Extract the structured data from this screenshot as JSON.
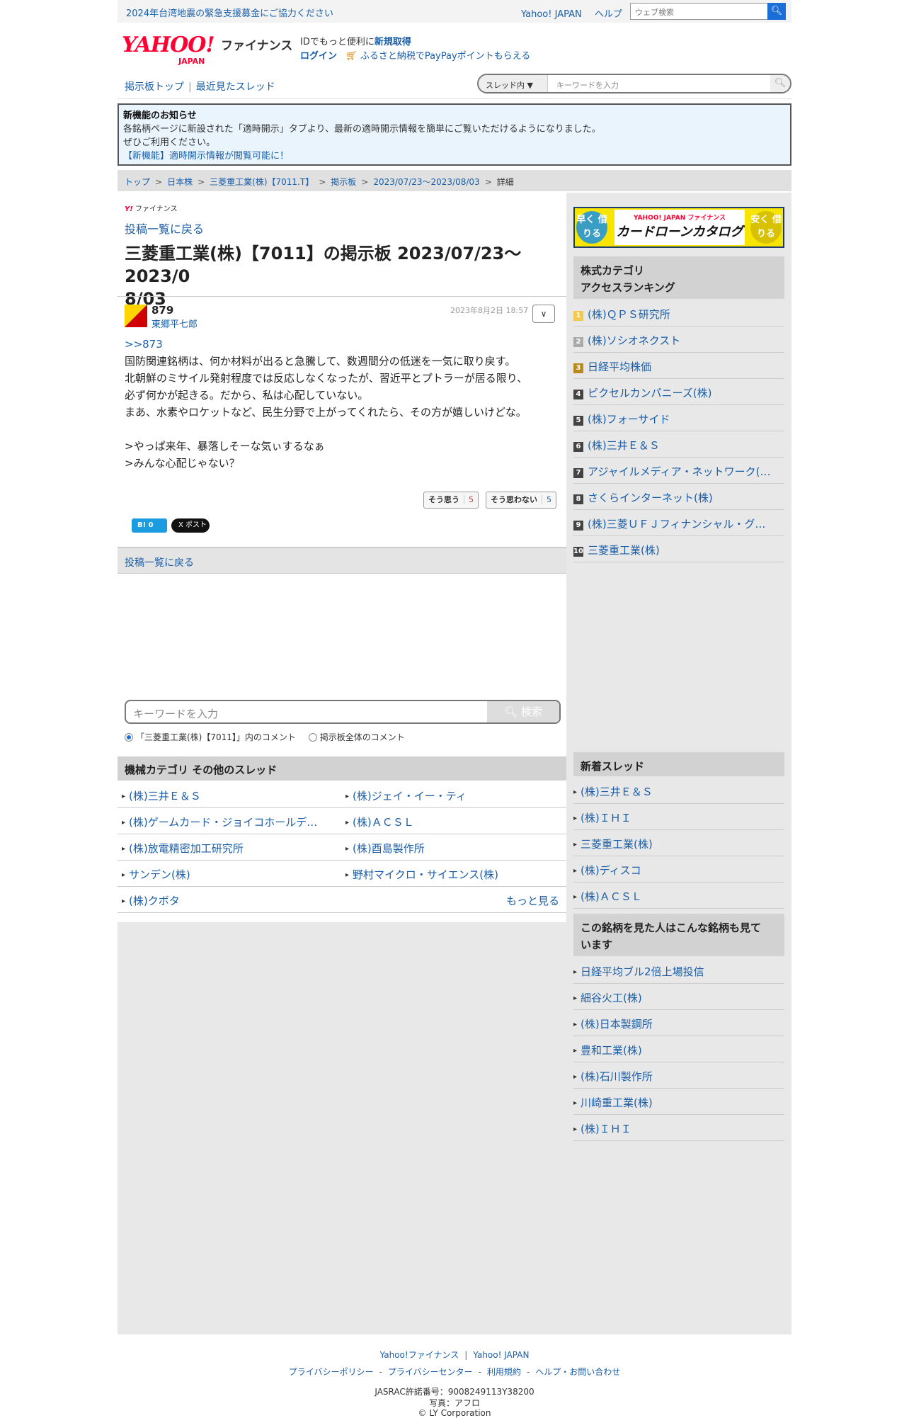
{
  "topbar": {
    "notice": "2024年台湾地震の緊急支援募金にご協力ください",
    "yahoo_japan": "Yahoo! JAPAN",
    "help": "ヘルプ",
    "search_placeholder": "ウェブ検索"
  },
  "header": {
    "logo": "YAHOO!",
    "logo_sub": "JAPAN",
    "logo_finance": "ファイナンス",
    "id_prefix": "IDでもっと便利に",
    "signup": "新規取得",
    "login": "ログイン",
    "promo": "ふるさと納税でPayPayポイントもらえる"
  },
  "boardnav": {
    "board_top": "掲示板トップ",
    "recent_threads": "最近見たスレッド",
    "scope": "スレッド内",
    "keyword_placeholder": "キーワードを入力"
  },
  "notice": {
    "title": "新機能のお知らせ",
    "line1": "各銘柄ページに新設された「適時開示」タブより、最新の適時開示情報を簡単にご覧いただけるようになりました。",
    "line2": "ぜひご利用ください。",
    "link": "【新機能】適時開示情報が閲覧可能に！"
  },
  "breadcrumb": [
    "トップ",
    "日本株",
    "三菱重工業(株)【7011.T】",
    "掲示板",
    "2023/07/23〜2023/08/03",
    "詳細"
  ],
  "post": {
    "mini_logo_y": "Y!",
    "mini_logo_text": "ファイナンス",
    "back_label": "投稿一覧に戻る",
    "title_line1": "三菱重工業(株)【7011】の掲示板 2023/07/23〜2023/0",
    "title_line2": "8/03",
    "number": "879",
    "author": "東郷平七郎",
    "date": "2023年8月2日 18:57",
    "reply_ref": ">>873",
    "body_lines": [
      "国防関連銘柄は、何か材料が出ると急騰して、数週間分の低迷を一気に取り戻す。",
      "北朝鮮のミサイル発射程度では反応しなくなったが、習近平とプトラーが居る限り、",
      "必ず何かが起きる。だから、私は心配していない。",
      "まあ、水素やロケットなど、民生分野で上がってくれたら、その方が嬉しいけどな。",
      "",
      ">やっぱ来年、暴落しそーな気ぃするなぁ",
      ">みんな心配じゃない？"
    ],
    "agree_label": "そう思う",
    "agree_count": "5",
    "disagree_label": "そう思わない",
    "disagree_count": "5",
    "hatena": "B! 0",
    "x_share": "X ポスト",
    "back_label_bottom": "投稿一覧に戻る"
  },
  "search": {
    "placeholder": "キーワードを入力",
    "button": "検索",
    "radio1": "「三菱重工業(株)【7011】」内のコメント",
    "radio2": "掲示板全体のコメント"
  },
  "other_threads": {
    "title": "機械カテゴリ  その他のスレッド",
    "rows": [
      [
        "(株)三井Ｅ＆Ｓ",
        "(株)ジェイ・イー・ティ"
      ],
      [
        "(株)ゲームカード・ジョイコホールデ…",
        "(株)ＡＣＳＬ"
      ],
      [
        "(株)放電精密加工研究所",
        "(株)酉島製作所"
      ],
      [
        "サンデン(株)",
        "野村マイクロ・サイエンス(株)"
      ],
      [
        "(株)クボタ",
        ""
      ]
    ],
    "more": "もっと見る"
  },
  "side": {
    "banner_left": "早く 借りる",
    "banner_right": "安く 借りる",
    "banner_logo": "YAHOO! JAPAN ファイナンス",
    "banner_title": "カードローンカタログ",
    "ranking_title_1": "株式カテゴリ",
    "ranking_title_2": "アクセスランキング",
    "ranking": [
      {
        "rank": "1",
        "name": "(株)ＱＰＳ研究所"
      },
      {
        "rank": "2",
        "name": "(株)ソシオネクスト"
      },
      {
        "rank": "3",
        "name": "日経平均株価"
      },
      {
        "rank": "4",
        "name": "ピクセルカンパニーズ(株)"
      },
      {
        "rank": "5",
        "name": "(株)フォーサイド"
      },
      {
        "rank": "6",
        "name": "(株)三井Ｅ＆Ｓ"
      },
      {
        "rank": "7",
        "name": "アジャイルメディア・ネットワーク(…"
      },
      {
        "rank": "8",
        "name": "さくらインターネット(株)"
      },
      {
        "rank": "9",
        "name": "(株)三菱ＵＦＪフィナンシャル・グ…"
      },
      {
        "rank": "10",
        "name": "三菱重工業(株)"
      }
    ],
    "new_threads_title": "新着スレッド",
    "new_threads": [
      "(株)三井Ｅ＆Ｓ",
      "(株)ＩＨＩ",
      "三菱重工業(株)",
      "(株)ディスコ",
      "(株)ＡＣＳＬ"
    ],
    "also_viewed_title_1": "この銘柄を見た人はこんな銘柄も見て",
    "also_viewed_title_2": "います",
    "also_viewed": [
      "日経平均ブル2倍上場投信",
      "細谷火工(株)",
      "(株)日本製鋼所",
      "豊和工業(株)",
      "(株)石川製作所",
      "川崎重工業(株)",
      "(株)ＩＨＩ"
    ]
  },
  "footer": {
    "links1": [
      "Yahoo!ファイナンス",
      "Yahoo! JAPAN"
    ],
    "links2": [
      "プライバシーポリシー",
      "プライバシーセンター",
      "利用規約",
      "ヘルプ・お問い合わせ"
    ],
    "jasrac": "JASRAC許諾番号：9008249113Y38200",
    "photo": "写真：アフロ",
    "copyright": "© LY Corporation"
  },
  "colors": {
    "link": "#1a5ea8",
    "brand_red": "#ff0033",
    "accent_blue": "#1a6ed8"
  }
}
